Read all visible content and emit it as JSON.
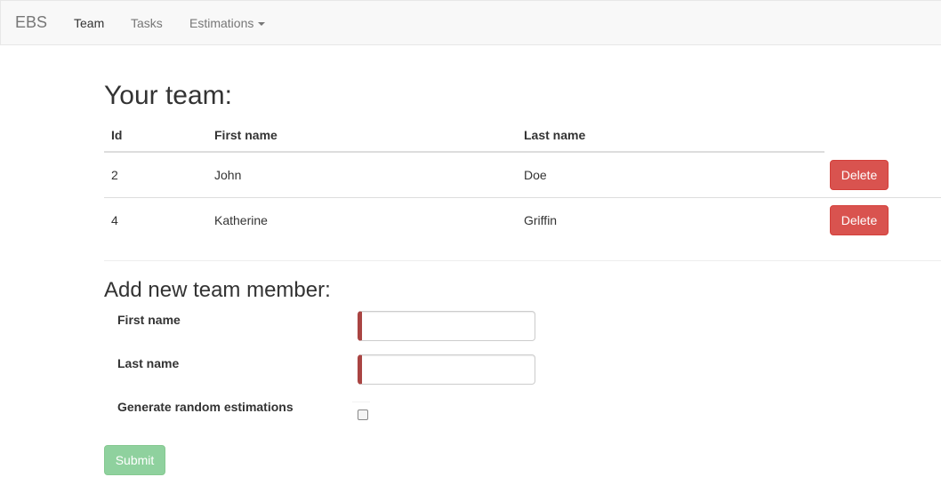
{
  "navbar": {
    "brand": "EBS",
    "items": [
      {
        "label": "Team",
        "active": true
      },
      {
        "label": "Tasks",
        "active": false
      },
      {
        "label": "Estimations",
        "active": false,
        "dropdown": true
      }
    ]
  },
  "team": {
    "title": "Your team:",
    "columns": [
      "Id",
      "First name",
      "Last name"
    ],
    "rows": [
      {
        "id": "2",
        "first_name": "John",
        "last_name": "Doe",
        "action": "Delete"
      },
      {
        "id": "4",
        "first_name": "Katherine",
        "last_name": "Griffin",
        "action": "Delete"
      }
    ]
  },
  "form": {
    "title": "Add new team member:",
    "first_name_label": "First name",
    "first_name_value": "",
    "last_name_label": "Last name",
    "last_name_value": "",
    "random_label": "Generate random estimations",
    "random_checked": false,
    "submit_label": "Submit"
  },
  "colors": {
    "danger": "#d9534f",
    "success_disabled": "#8fd19e",
    "error_border": "#a94442",
    "navbar_bg": "#f8f8f8"
  },
  "icons": {
    "dropdown": "caret-down-icon"
  }
}
